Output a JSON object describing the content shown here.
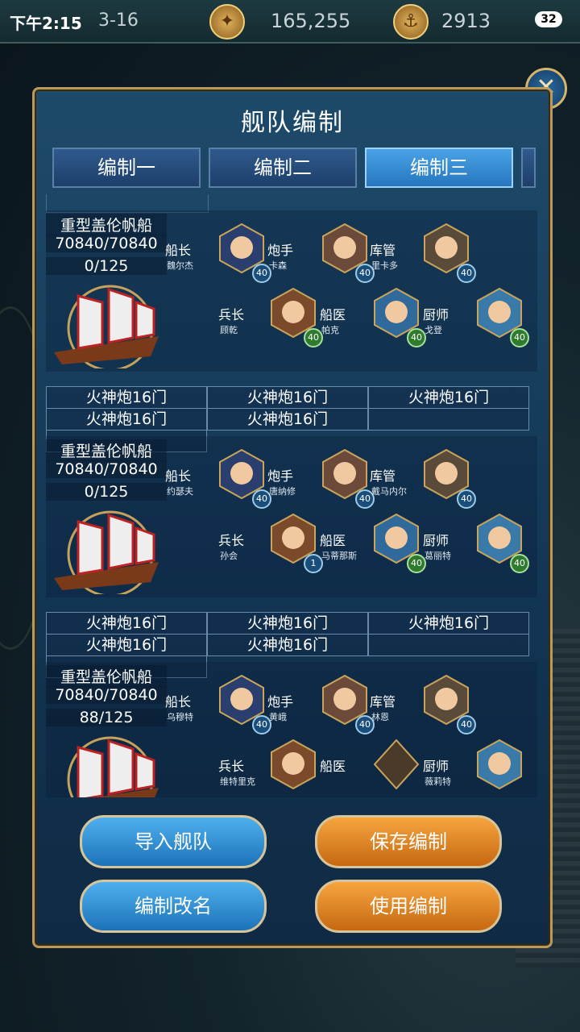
{
  "status": {
    "time": "下午2:15",
    "date": "3-16",
    "battery": "32"
  },
  "resources": {
    "compass_value": "165,255",
    "anchor_value": "2913"
  },
  "dialog": {
    "title": "舰队编制",
    "close_label": "✕",
    "tabs": [
      "编制一",
      "编制二",
      "编制三"
    ],
    "active_tab": 2
  },
  "fleets": [
    {
      "ship_name": "重型盖伦帆船",
      "hp": "70840/70840",
      "cargo": "0/125",
      "crew": [
        {
          "role": "船长",
          "name": "魏尔杰",
          "level": "40"
        },
        {
          "role": "炮手",
          "name": "卡森",
          "level": "40"
        },
        {
          "role": "库管",
          "name": "里卡多",
          "level": "40"
        },
        {
          "role": "兵长",
          "name": "顾乾",
          "level": "40"
        },
        {
          "role": "船医",
          "name": "帕克",
          "level": "40"
        },
        {
          "role": "厨师",
          "name": "戈登",
          "level": "40"
        }
      ],
      "cannons": [
        "火神炮16门",
        "火神炮16门",
        "火神炮16门",
        "火神炮16门",
        "火神炮16门"
      ]
    },
    {
      "ship_name": "重型盖伦帆船",
      "hp": "70840/70840",
      "cargo": "0/125",
      "crew": [
        {
          "role": "船长",
          "name": "约瑟夫",
          "level": "40"
        },
        {
          "role": "炮手",
          "name": "唐纳修",
          "level": "40"
        },
        {
          "role": "库管",
          "name": "戴马内尔",
          "level": "40"
        },
        {
          "role": "兵长",
          "name": "孙会",
          "level": "1"
        },
        {
          "role": "船医",
          "name": "马蒂那斯",
          "level": "40"
        },
        {
          "role": "厨师",
          "name": "葛丽特",
          "level": "40"
        }
      ],
      "cannons": [
        "火神炮16门",
        "火神炮16门",
        "火神炮16门",
        "火神炮16门",
        "火神炮16门"
      ]
    },
    {
      "ship_name": "重型盖伦帆船",
      "hp": "70840/70840",
      "cargo": "88/125",
      "crew": [
        {
          "role": "船长",
          "name": "乌穆特",
          "level": "40"
        },
        {
          "role": "炮手",
          "name": "黄峨",
          "level": "40"
        },
        {
          "role": "库管",
          "name": "林恩",
          "level": "40"
        },
        {
          "role": "兵长",
          "name": "维特里克",
          "level": ""
        },
        {
          "role": "船医",
          "name": "",
          "level": ""
        },
        {
          "role": "厨师",
          "name": "薇莉特",
          "level": ""
        }
      ],
      "cannons": []
    }
  ],
  "buttons": {
    "import": "导入舰队",
    "save": "保存编制",
    "rename": "编制改名",
    "use": "使用编制"
  },
  "colors": {
    "accent_blue": "#2676be",
    "accent_orange": "#c66810",
    "frame_gold": "#b99a5a"
  }
}
